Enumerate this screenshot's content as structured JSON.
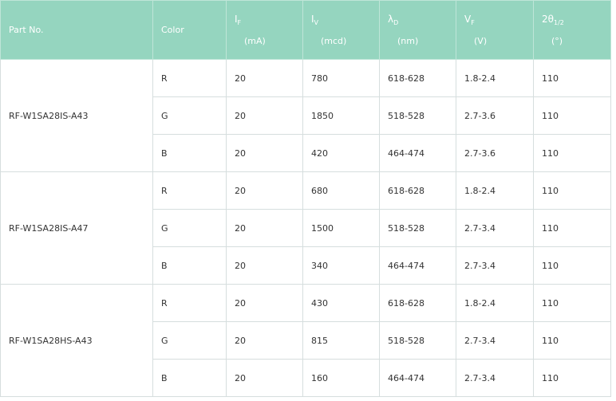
{
  "header": {
    "part_no": "Part No.",
    "color": "Color",
    "if": {
      "symbol": "I",
      "sub": "F",
      "unit": "(mA)"
    },
    "iv": {
      "symbol": "I",
      "sub": "V",
      "unit": "(mcd)"
    },
    "ld": {
      "symbol": "λ",
      "sub": "D",
      "unit": "(nm)"
    },
    "vf": {
      "symbol": "V",
      "sub": "F",
      "unit": "(V)"
    },
    "theta": {
      "symbol": "2θ",
      "sub": "1/2",
      "unit": "(°)"
    }
  },
  "groups": [
    {
      "part_no": "RF-W1SA28IS-A43",
      "rows": [
        {
          "color": "R",
          "if": "20",
          "iv": "780",
          "ld": "618-628",
          "vf": "1.8-2.4",
          "theta": "110"
        },
        {
          "color": "G",
          "if": "20",
          "iv": "1850",
          "ld": "518-528",
          "vf": "2.7-3.6",
          "theta": "110"
        },
        {
          "color": "B",
          "if": "20",
          "iv": "420",
          "ld": "464-474",
          "vf": "2.7-3.6",
          "theta": "110"
        }
      ]
    },
    {
      "part_no": "RF-W1SA28IS-A47",
      "rows": [
        {
          "color": "R",
          "if": "20",
          "iv": "680",
          "ld": "618-628",
          "vf": "1.8-2.4",
          "theta": "110"
        },
        {
          "color": "G",
          "if": "20",
          "iv": "1500",
          "ld": "518-528",
          "vf": "2.7-3.4",
          "theta": "110"
        },
        {
          "color": "B",
          "if": "20",
          "iv": "340",
          "ld": "464-474",
          "vf": "2.7-3.4",
          "theta": "110"
        }
      ]
    },
    {
      "part_no": "RF-W1SA28HS-A43",
      "rows": [
        {
          "color": "R",
          "if": "20",
          "iv": "430",
          "ld": "618-628",
          "vf": "1.8-2.4",
          "theta": "110"
        },
        {
          "color": "G",
          "if": "20",
          "iv": "815",
          "ld": "518-528",
          "vf": "2.7-3.4",
          "theta": "110"
        },
        {
          "color": "B",
          "if": "20",
          "iv": "160",
          "ld": "464-474",
          "vf": "2.7-3.4",
          "theta": "110"
        }
      ]
    }
  ],
  "colors": {
    "header_bg": "#95d5bf",
    "header_text": "#ffffff",
    "border": "#d6dede",
    "body_text": "#333333"
  }
}
